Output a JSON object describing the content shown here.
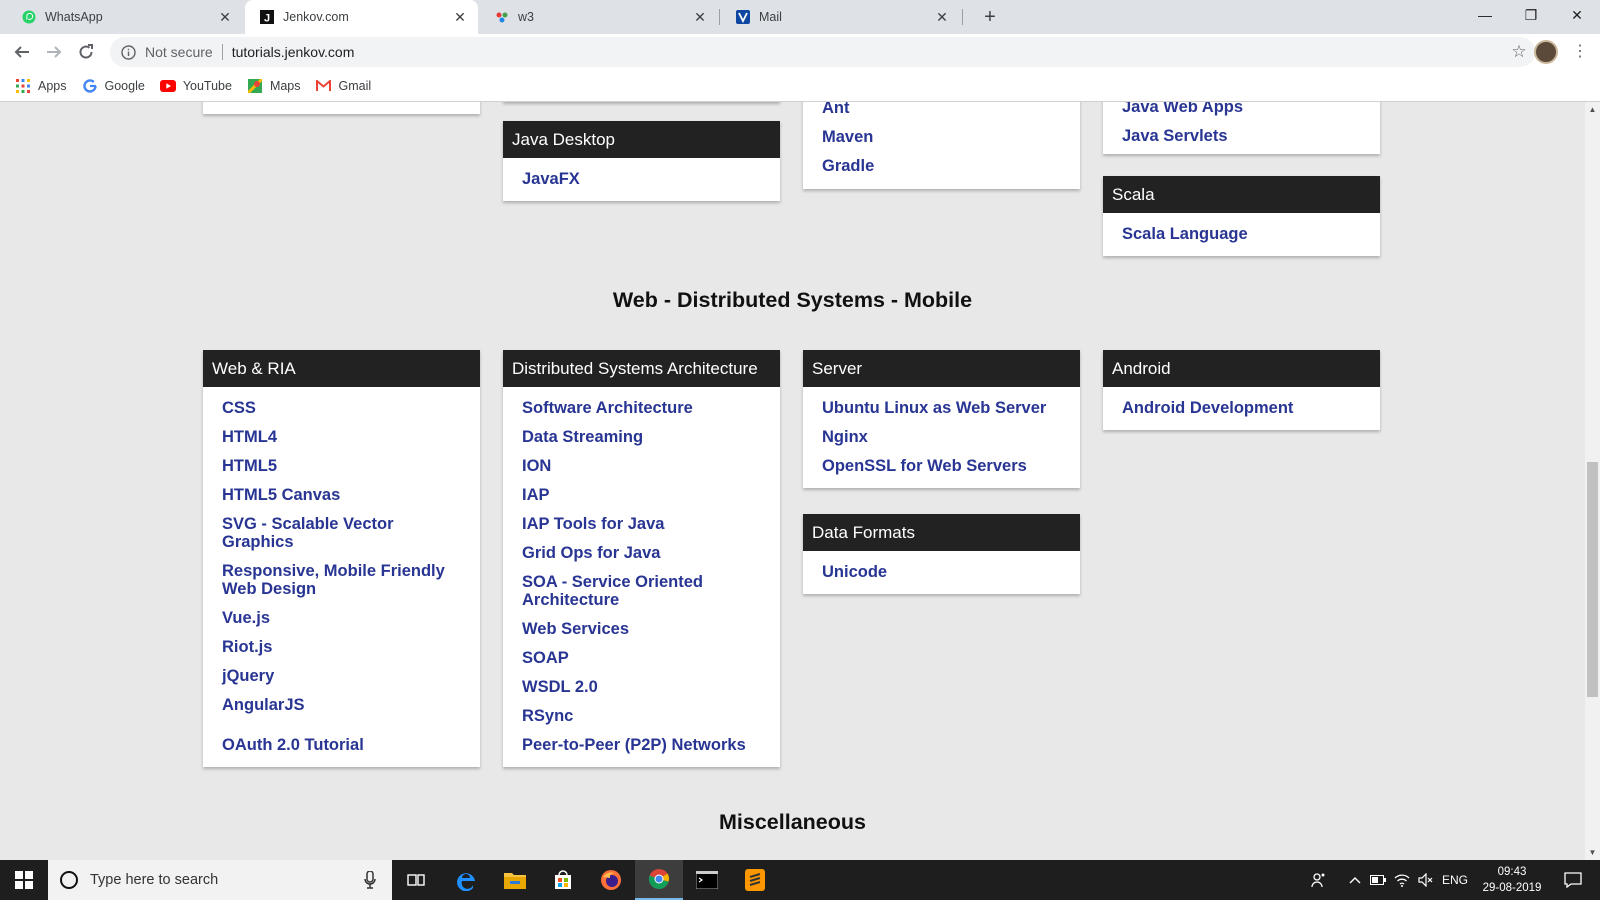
{
  "browser": {
    "tabs": [
      {
        "label": "WhatsApp",
        "icon": "whatsapp-icon"
      },
      {
        "label": "Jenkov.com",
        "icon": "jenkov-icon"
      },
      {
        "label": "w3",
        "icon": "w3-icon"
      },
      {
        "label": "Mail",
        "icon": "mail-icon"
      }
    ],
    "address": {
      "security": "Not secure",
      "url": "tutorials.jenkov.com"
    },
    "bookmarks": [
      {
        "label": "Apps"
      },
      {
        "label": "Google"
      },
      {
        "label": "YouTube"
      },
      {
        "label": "Maps"
      },
      {
        "label": "Gmail"
      }
    ]
  },
  "page": {
    "top_cards": [
      {
        "title": "Java Desktop",
        "links": [
          "JavaFX"
        ]
      },
      {
        "title": "",
        "links": [
          "Ant",
          "Maven",
          "Gradle"
        ]
      },
      {
        "title": "",
        "links": [
          "Java Web Apps",
          "Java Servlets"
        ]
      },
      {
        "title": "Scala",
        "links": [
          "Scala Language"
        ]
      }
    ],
    "section_title": "Web - Distributed Systems - Mobile",
    "cards": [
      {
        "title": "Web & RIA",
        "links": [
          "CSS",
          "HTML4",
          "HTML5",
          "HTML5 Canvas",
          "SVG - Scalable Vector Graphics",
          "Responsive, Mobile Friendly Web Design",
          "Vue.js",
          "Riot.js",
          "jQuery",
          "AngularJS",
          "OAuth 2.0 Tutorial"
        ]
      },
      {
        "title": "Distributed Systems Architecture",
        "links": [
          "Software Architecture",
          "Data Streaming",
          "ION",
          "IAP",
          "IAP Tools for Java",
          "Grid Ops for Java",
          "SOA - Service Oriented Architecture",
          "Web Services",
          "SOAP",
          "WSDL 2.0",
          "RSync",
          "Peer-to-Peer (P2P) Networks"
        ]
      },
      {
        "title": "Server",
        "links": [
          "Ubuntu Linux as Web Server",
          "Nginx",
          "OpenSSL for Web Servers"
        ]
      },
      {
        "title": "Data Formats",
        "links": [
          "Unicode"
        ]
      },
      {
        "title": "Android",
        "links": [
          "Android Development"
        ]
      }
    ],
    "next_section_title": "Miscellaneous"
  },
  "taskbar": {
    "search_placeholder": "Type here to search",
    "language": "ENG",
    "time": "09:43",
    "date": "29-08-2019"
  },
  "colors": {
    "link": "#283593",
    "card_header": "#222222",
    "page_bg": "#e8e8e8"
  }
}
